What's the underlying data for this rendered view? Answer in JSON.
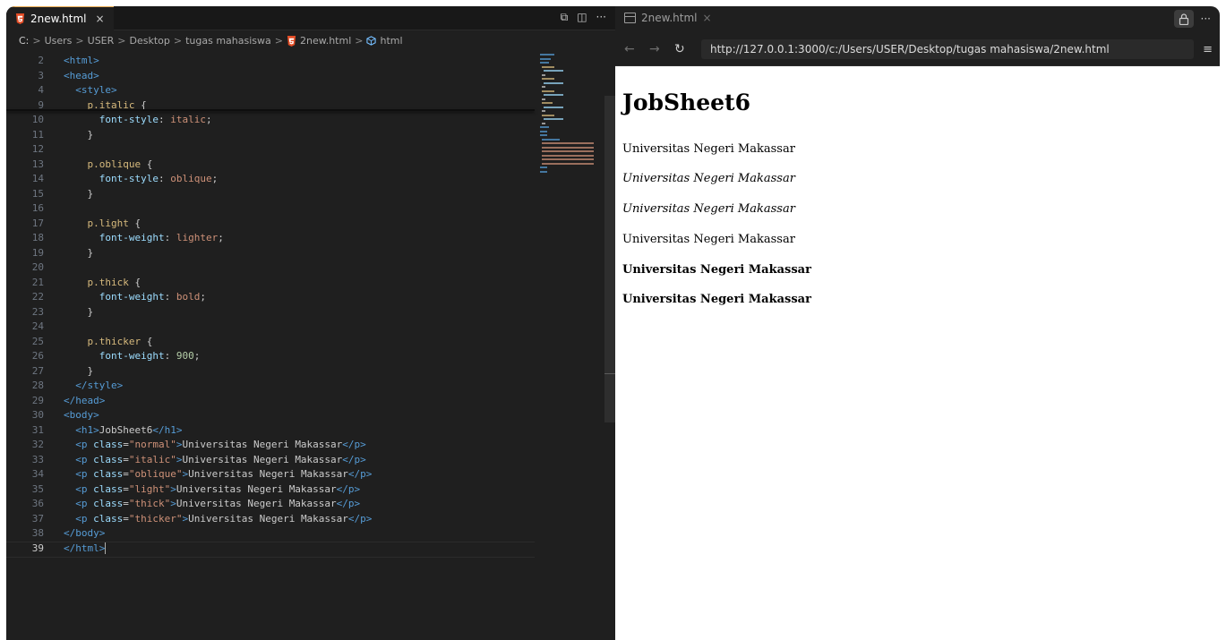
{
  "editor": {
    "tab_label": "2new.html",
    "tab_close": "×",
    "tab_actions": [
      "⧉",
      "◫",
      "···"
    ],
    "breadcrumb": {
      "drive": "C:",
      "items": [
        "Users",
        "USER",
        "Desktop",
        "tugas mahasiswa",
        "2new.html",
        "html"
      ],
      "separator": ">"
    },
    "lines": [
      {
        "n": "2",
        "segs": [
          [
            "t",
            "<html>"
          ]
        ]
      },
      {
        "n": "3",
        "segs": [
          [
            "t",
            "<head>"
          ]
        ]
      },
      {
        "n": "4",
        "segs": [
          [
            "w",
            "  "
          ],
          [
            "t",
            "<style>"
          ]
        ]
      },
      {
        "n": "9",
        "segs": [
          [
            "w",
            "    "
          ],
          [
            "sel",
            "p.italic"
          ],
          [
            "w",
            " {"
          ]
        ]
      },
      {
        "n": "10",
        "segs": [
          [
            "w",
            "      "
          ],
          [
            "a",
            "font-style"
          ],
          [
            "w",
            ": "
          ],
          [
            "s",
            "italic"
          ],
          [
            "w",
            ";"
          ]
        ]
      },
      {
        "n": "11",
        "segs": [
          [
            "w",
            "    }"
          ]
        ]
      },
      {
        "n": "12",
        "segs": []
      },
      {
        "n": "13",
        "segs": [
          [
            "w",
            "    "
          ],
          [
            "sel",
            "p.oblique"
          ],
          [
            "w",
            " {"
          ]
        ]
      },
      {
        "n": "14",
        "segs": [
          [
            "w",
            "      "
          ],
          [
            "a",
            "font-style"
          ],
          [
            "w",
            ": "
          ],
          [
            "s",
            "oblique"
          ],
          [
            "w",
            ";"
          ]
        ]
      },
      {
        "n": "15",
        "segs": [
          [
            "w",
            "    }"
          ]
        ]
      },
      {
        "n": "16",
        "segs": []
      },
      {
        "n": "17",
        "segs": [
          [
            "w",
            "    "
          ],
          [
            "sel",
            "p.light"
          ],
          [
            "w",
            " {"
          ]
        ]
      },
      {
        "n": "18",
        "segs": [
          [
            "w",
            "      "
          ],
          [
            "a",
            "font-weight"
          ],
          [
            "w",
            ": "
          ],
          [
            "s",
            "lighter"
          ],
          [
            "w",
            ";"
          ]
        ]
      },
      {
        "n": "19",
        "segs": [
          [
            "w",
            "    }"
          ]
        ]
      },
      {
        "n": "20",
        "segs": []
      },
      {
        "n": "21",
        "segs": [
          [
            "w",
            "    "
          ],
          [
            "sel",
            "p.thick"
          ],
          [
            "w",
            " {"
          ]
        ]
      },
      {
        "n": "22",
        "segs": [
          [
            "w",
            "      "
          ],
          [
            "a",
            "font-weight"
          ],
          [
            "w",
            ": "
          ],
          [
            "s",
            "bold"
          ],
          [
            "w",
            ";"
          ]
        ]
      },
      {
        "n": "23",
        "segs": [
          [
            "w",
            "    }"
          ]
        ]
      },
      {
        "n": "24",
        "segs": []
      },
      {
        "n": "25",
        "segs": [
          [
            "w",
            "    "
          ],
          [
            "sel",
            "p.thicker"
          ],
          [
            "w",
            " {"
          ]
        ]
      },
      {
        "n": "26",
        "segs": [
          [
            "w",
            "      "
          ],
          [
            "a",
            "font-weight"
          ],
          [
            "w",
            ": "
          ],
          [
            "n",
            "900"
          ],
          [
            "w",
            ";"
          ]
        ]
      },
      {
        "n": "27",
        "segs": [
          [
            "w",
            "    }"
          ]
        ]
      },
      {
        "n": "28",
        "segs": [
          [
            "w",
            "  "
          ],
          [
            "t",
            "</style>"
          ]
        ]
      },
      {
        "n": "29",
        "segs": [
          [
            "t",
            "</head>"
          ]
        ]
      },
      {
        "n": "30",
        "segs": [
          [
            "t",
            "<body>"
          ]
        ]
      },
      {
        "n": "31",
        "segs": [
          [
            "w",
            "  "
          ],
          [
            "t",
            "<h1>"
          ],
          [
            "w",
            "JobSheet6"
          ],
          [
            "t",
            "</h1>"
          ]
        ]
      },
      {
        "n": "32",
        "segs": [
          [
            "w",
            "  "
          ],
          [
            "t",
            "<p "
          ],
          [
            "at",
            "class"
          ],
          [
            "w",
            "="
          ],
          [
            "s",
            "\"normal\""
          ],
          [
            "t",
            ">"
          ],
          [
            "w",
            "Universitas Negeri Makassar"
          ],
          [
            "t",
            "</p>"
          ]
        ]
      },
      {
        "n": "33",
        "segs": [
          [
            "w",
            "  "
          ],
          [
            "t",
            "<p "
          ],
          [
            "at",
            "class"
          ],
          [
            "w",
            "="
          ],
          [
            "s",
            "\"italic\""
          ],
          [
            "t",
            ">"
          ],
          [
            "w",
            "Universitas Negeri Makassar"
          ],
          [
            "t",
            "</p>"
          ]
        ]
      },
      {
        "n": "34",
        "segs": [
          [
            "w",
            "  "
          ],
          [
            "t",
            "<p "
          ],
          [
            "at",
            "class"
          ],
          [
            "w",
            "="
          ],
          [
            "s",
            "\"oblique\""
          ],
          [
            "t",
            ">"
          ],
          [
            "w",
            "Universitas Negeri Makassar"
          ],
          [
            "t",
            "</p>"
          ]
        ]
      },
      {
        "n": "35",
        "segs": [
          [
            "w",
            "  "
          ],
          [
            "t",
            "<p "
          ],
          [
            "at",
            "class"
          ],
          [
            "w",
            "="
          ],
          [
            "s",
            "\"light\""
          ],
          [
            "t",
            ">"
          ],
          [
            "w",
            "Universitas Negeri Makassar"
          ],
          [
            "t",
            "</p>"
          ]
        ]
      },
      {
        "n": "36",
        "segs": [
          [
            "w",
            "  "
          ],
          [
            "t",
            "<p "
          ],
          [
            "at",
            "class"
          ],
          [
            "w",
            "="
          ],
          [
            "s",
            "\"thick\""
          ],
          [
            "t",
            ">"
          ],
          [
            "w",
            "Universitas Negeri Makassar"
          ],
          [
            "t",
            "</p>"
          ]
        ]
      },
      {
        "n": "37",
        "segs": [
          [
            "w",
            "  "
          ],
          [
            "t",
            "<p "
          ],
          [
            "at",
            "class"
          ],
          [
            "w",
            "="
          ],
          [
            "s",
            "\"thicker\""
          ],
          [
            "t",
            ">"
          ],
          [
            "w",
            "Universitas Negeri Makassar"
          ],
          [
            "t",
            "</p>"
          ]
        ]
      },
      {
        "n": "38",
        "segs": [
          [
            "t",
            "</body>"
          ]
        ]
      },
      {
        "n": "39",
        "segs": [
          [
            "t",
            "</html>"
          ]
        ],
        "active": true
      }
    ]
  },
  "browser": {
    "tab_label": "2new.html",
    "tab_close": "×",
    "more": "···",
    "back": "←",
    "forward": "→",
    "reload": "↻",
    "url": "http://127.0.0.1:3000/c:/Users/USER/Desktop/tugas mahasiswa/2new.html",
    "menu": "≡",
    "page": {
      "heading": "JobSheet6",
      "paragraphs": [
        "Universitas Negeri Makassar",
        "Universitas Negeri Makassar",
        "Universitas Negeri Makassar",
        "Universitas Negeri Makassar",
        "Universitas Negeri Makassar",
        "Universitas Negeri Makassar"
      ]
    }
  },
  "colors": {
    "tag": "#569cd6",
    "string": "#ce9178",
    "property": "#9cdcfe",
    "selector": "#d7ba7d",
    "number": "#b5cea8",
    "html5_icon": "#e44d26"
  }
}
